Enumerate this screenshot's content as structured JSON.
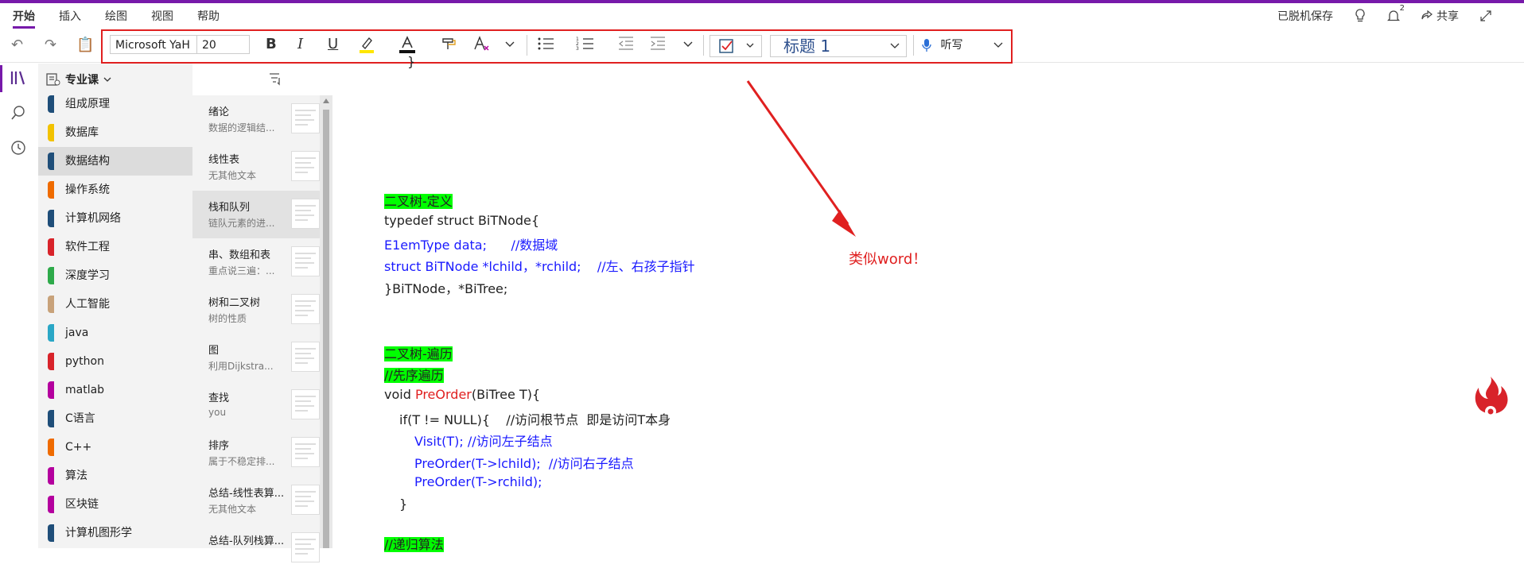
{
  "menu": {
    "tabs": [
      "开始",
      "插入",
      "绘图",
      "视图",
      "帮助"
    ],
    "offline_status": "已脱机保存",
    "notifications_count": "2",
    "share_label": "共享"
  },
  "toolbar": {
    "font_name": "Microsoft YaH",
    "font_size": "20",
    "bold": "B",
    "italic": "I",
    "underline": "U",
    "style_value": "标题 1",
    "dictate_label": "听写"
  },
  "notebook": {
    "name": "专业课",
    "sections": [
      {
        "label": "组成原理",
        "color": "#1f4e79"
      },
      {
        "label": "数据库",
        "color": "#f2c200"
      },
      {
        "label": "数据结构",
        "color": "#1f4e79"
      },
      {
        "label": "操作系统",
        "color": "#ef6b00"
      },
      {
        "label": "计算机网络",
        "color": "#1f4e79"
      },
      {
        "label": "软件工程",
        "color": "#d8232a"
      },
      {
        "label": "深度学习",
        "color": "#2eaa4a"
      },
      {
        "label": "人工智能",
        "color": "#c8a27a"
      },
      {
        "label": "java",
        "color": "#2aa7c6"
      },
      {
        "label": "python",
        "color": "#d8232a"
      },
      {
        "label": "matlab",
        "color": "#b4009e"
      },
      {
        "label": "C语言",
        "color": "#1f4e79"
      },
      {
        "label": "C++",
        "color": "#ef6b00"
      },
      {
        "label": "算法",
        "color": "#b4009e"
      },
      {
        "label": "区块链",
        "color": "#b4009e"
      },
      {
        "label": "计算机图形学",
        "color": "#1f4e79"
      }
    ],
    "selected_section": "数据结构"
  },
  "pages": [
    {
      "title": "绪论",
      "subtitle": "数据的逻辑结..."
    },
    {
      "title": "线性表",
      "subtitle": "无其他文本"
    },
    {
      "title": "栈和队列",
      "subtitle": "链队元素的进..."
    },
    {
      "title": "串、数组和表",
      "subtitle": "重点说三遍：..."
    },
    {
      "title": "树和二叉树",
      "subtitle": "树的性质"
    },
    {
      "title": "图",
      "subtitle": "利用Dijkstra..."
    },
    {
      "title": "查找",
      "subtitle": "you"
    },
    {
      "title": "排序",
      "subtitle": "属于不稳定排..."
    },
    {
      "title": "总结-线性表算...",
      "subtitle": "无其他文本"
    },
    {
      "title": "总结-队列栈算...",
      "subtitle": ""
    }
  ],
  "content": {
    "brace_top": "}",
    "h1": "二叉树-定义",
    "l1": "typedef struct BiTNode{",
    "l2": "E1emType data;      //数据域",
    "l3": "struct BiTNode *lchild，*rchild;    //左、右孩子指针",
    "l4": "}BiTNode，*BiTree;",
    "h2": "二叉树-遍历",
    "h3": "//先序遍历",
    "l5a": "void ",
    "l5b": "PreOrder",
    "l5c": "(BiTree T){",
    "l6": "if(T != NULL){    //访问根节点  即是访问T本身",
    "l7": "Visit(T); //访问左子结点",
    "l8": "PreOrder(T->lchild);  //访问右子结点",
    "l9": "PreOrder(T->rchild);",
    "l10": "}",
    "h4": "//递归算法"
  },
  "annotation": "类似word！"
}
